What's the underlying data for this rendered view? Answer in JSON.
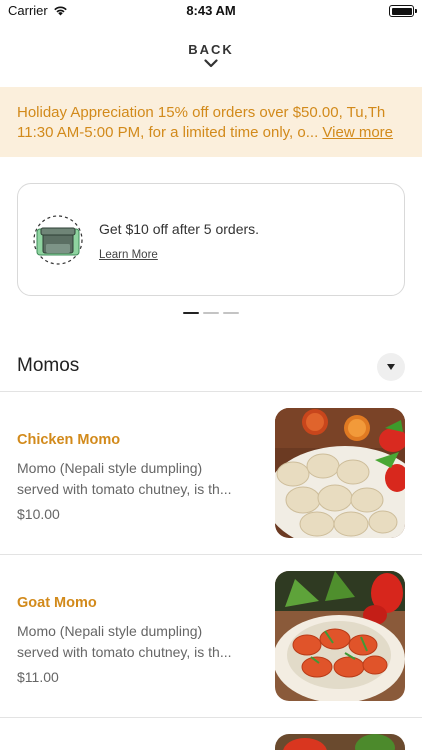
{
  "status_bar": {
    "carrier": "Carrier",
    "time": "8:43 AM"
  },
  "back": {
    "label": "BACK"
  },
  "promo": {
    "text": "Holiday Appreciation 15% off orders over $50.00, Tu,Th 11:30 AM-5:00 PM, for a limited time only, o...",
    "link": "View more"
  },
  "reward": {
    "title": "Get $10 off after 5 orders.",
    "link": "Learn More"
  },
  "carousel": {
    "pages": 3,
    "active": 0
  },
  "category": {
    "title": "Momos"
  },
  "items": [
    {
      "name": "Chicken Momo",
      "desc_line1": "Momo (Nepali style dumpling)",
      "desc_line2": "served with tomato chutney, is th...",
      "price": "$10.00"
    },
    {
      "name": "Goat Momo",
      "desc_line1": "Momo (Nepali style dumpling)",
      "desc_line2": "served with tomato chutney, is th...",
      "price": "$11.00"
    }
  ],
  "colors": {
    "accent": "#d28a1b",
    "promo_bg": "#fbefdc",
    "icon_green": "#7ec98f"
  }
}
